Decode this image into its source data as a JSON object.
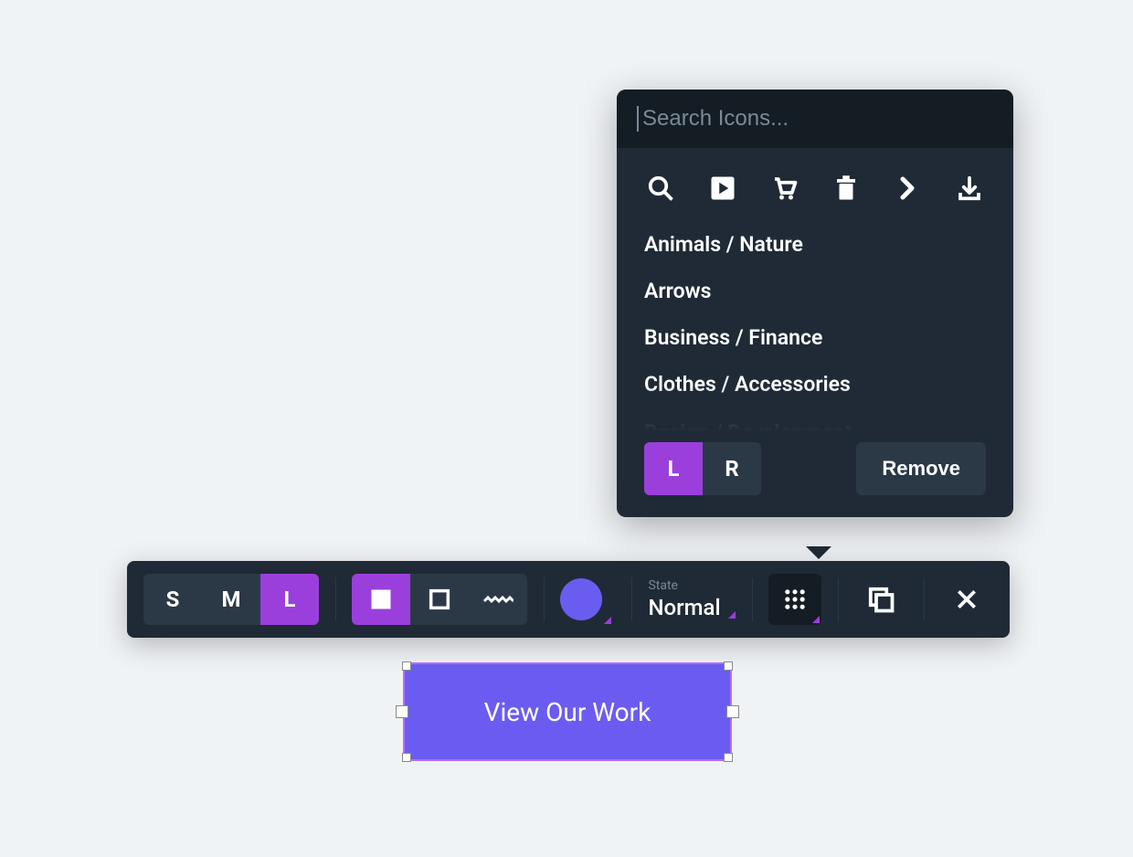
{
  "iconPanel": {
    "searchPlaceholder": "Search Icons...",
    "categories": [
      "Animals / Nature",
      "Arrows",
      "Business / Finance",
      "Clothes / Accessories",
      "Design / Development"
    ],
    "lrToggle": {
      "left": "L",
      "right": "R",
      "active": "L"
    },
    "removeLabel": "Remove"
  },
  "toolbar": {
    "sizes": {
      "s": "S",
      "m": "M",
      "l": "L",
      "active": "L"
    },
    "state": {
      "label": "State",
      "value": "Normal"
    },
    "colorSwatch": "#6a5cf0"
  },
  "selectedElement": {
    "label": "View Our Work"
  }
}
